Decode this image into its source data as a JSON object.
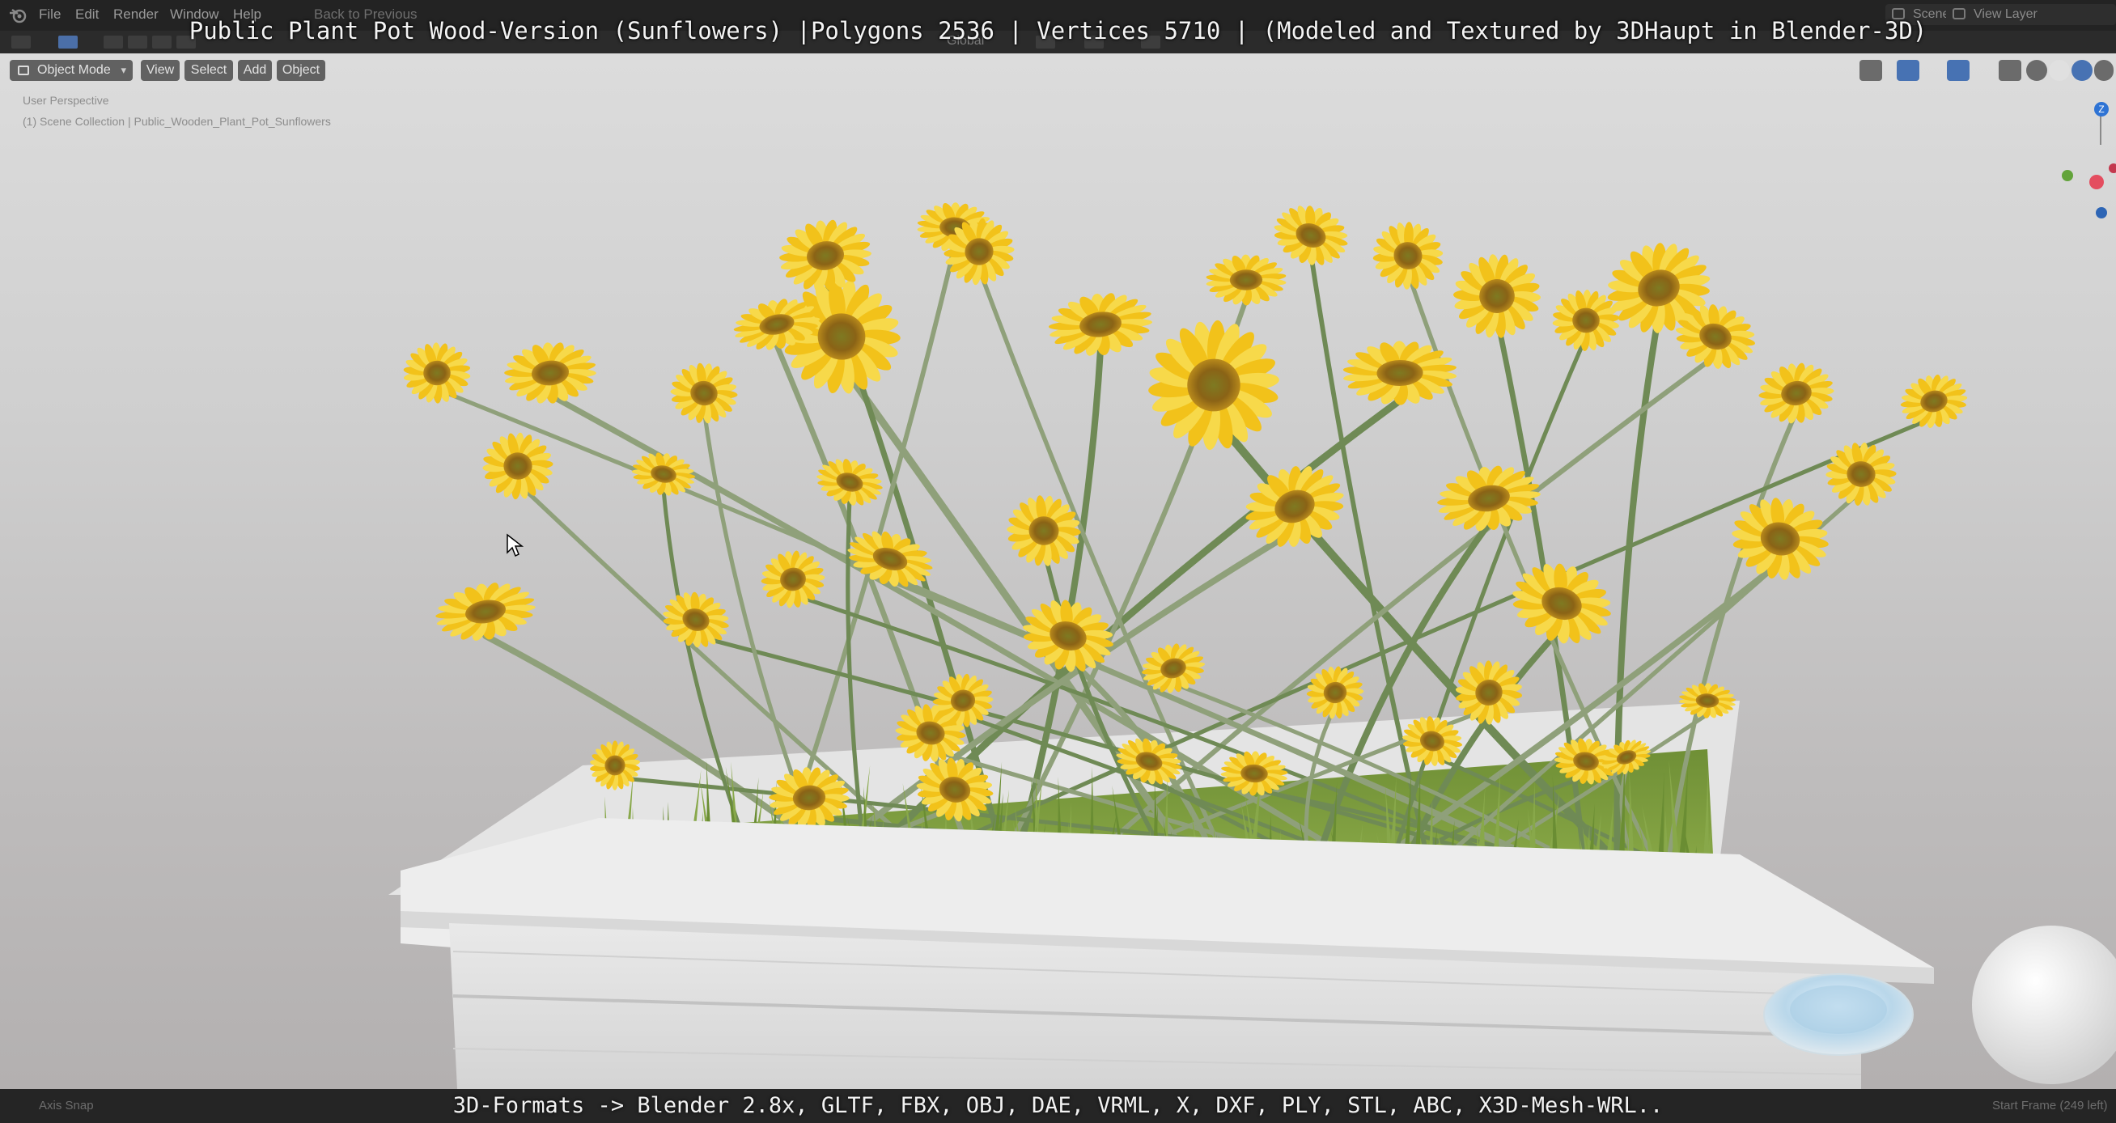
{
  "overlay": {
    "title": "Public Plant Pot Wood-Version (Sunflowers) |Polygons 2536 | Vertices 5710 | (Modeled and Textured by 3DHaupt in Blender-3D)",
    "formats": "3D-Formats -> Blender 2.8x, GLTF, FBX, OBJ, DAE, VRML, X, DXF, PLY, STL, ABC, X3D-Mesh-WRL.."
  },
  "menubar": {
    "items": [
      "File",
      "Edit",
      "Render",
      "Window",
      "Help"
    ],
    "back_to_previous": "Back to Previous",
    "scene": "Scene",
    "view_layer": "View Layer"
  },
  "header": {
    "transform_orientation": "Global"
  },
  "viewport": {
    "mode": "Object Mode",
    "menus": [
      "View",
      "Select",
      "Add",
      "Object"
    ],
    "info_line_1": "User Perspective",
    "info_line_2": "(1) Scene Collection | Public_Wooden_Plant_Pot_Sunflowers",
    "gizmo_z": "Z"
  },
  "statusbar": {
    "left": "Axis Snap",
    "right": "Start Frame (249 left)"
  },
  "colors": {
    "background_top": "#dcdcdc",
    "petal": "#f2c21a",
    "petal_light": "#f7d94a",
    "center": "#7a5a12",
    "stem": "#6f8a55",
    "grass": "#7a9a3a",
    "pot": "#e8e8e8",
    "selection_blue": "#4772b3"
  },
  "icons": {
    "app": "blender-logo-icon",
    "mode": "object-mode-icon",
    "gizmo": "navigation-gizmo-icon"
  }
}
